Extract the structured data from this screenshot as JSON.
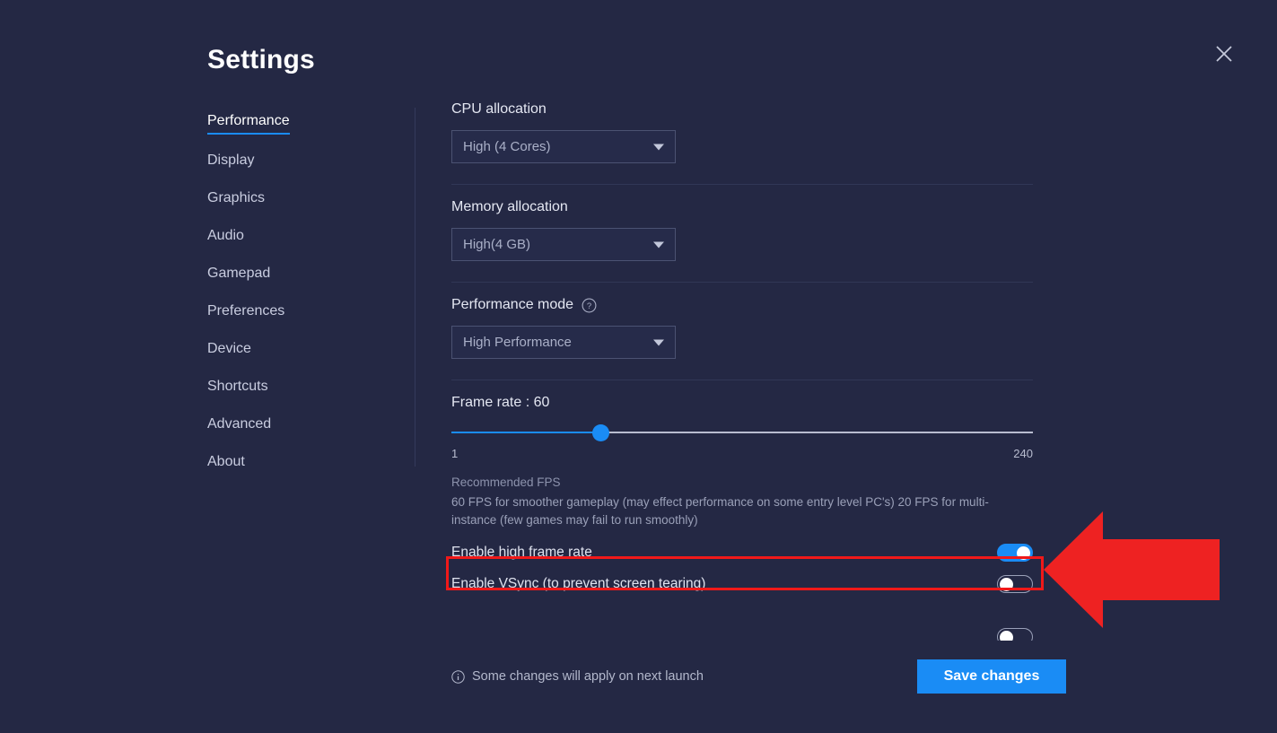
{
  "window": {
    "title": "Settings",
    "close_icon": "close-icon"
  },
  "sidebar": {
    "active": "Performance",
    "items": [
      {
        "label": "Performance",
        "active": true
      },
      {
        "label": "Display",
        "active": false
      },
      {
        "label": "Graphics",
        "active": false
      },
      {
        "label": "Audio",
        "active": false
      },
      {
        "label": "Gamepad",
        "active": false
      },
      {
        "label": "Preferences",
        "active": false
      },
      {
        "label": "Device",
        "active": false
      },
      {
        "label": "Shortcuts",
        "active": false
      },
      {
        "label": "Advanced",
        "active": false
      },
      {
        "label": "About",
        "active": false
      }
    ]
  },
  "main": {
    "cpu": {
      "label": "CPU allocation",
      "value": "High (4 Cores)"
    },
    "memory": {
      "label": "Memory allocation",
      "value": "High(4 GB)"
    },
    "performance_mode": {
      "label": "Performance mode",
      "help_icon": "question-mark-icon",
      "value": "High Performance"
    },
    "frame_rate": {
      "label": "Frame rate : 60",
      "value": 60,
      "min": 1,
      "max": 240,
      "min_label": "1",
      "max_label": "240",
      "fill_percent": 25.6
    },
    "recommended": {
      "title": "Recommended FPS",
      "body": "60 FPS for smoother gameplay (may effect performance on some entry level PC's) 20 FPS for multi-instance (few games may fail to run smoothly)"
    },
    "toggles": [
      {
        "label": "Enable high frame rate",
        "on": true
      },
      {
        "label": "Enable VSync (to prevent screen tearing)",
        "on": false
      }
    ]
  },
  "footer": {
    "info_icon": "info-icon",
    "note": "Some changes will apply on next launch",
    "save_label": "Save changes"
  },
  "annotation": {
    "highlight_color": "#f01919",
    "arrow_color": "#ee2222",
    "arrow_direction": "left"
  },
  "colors": {
    "background": "#242844",
    "accent": "#1a8cf5",
    "text_primary": "#ffffff",
    "text_secondary": "#9aa0b8"
  }
}
